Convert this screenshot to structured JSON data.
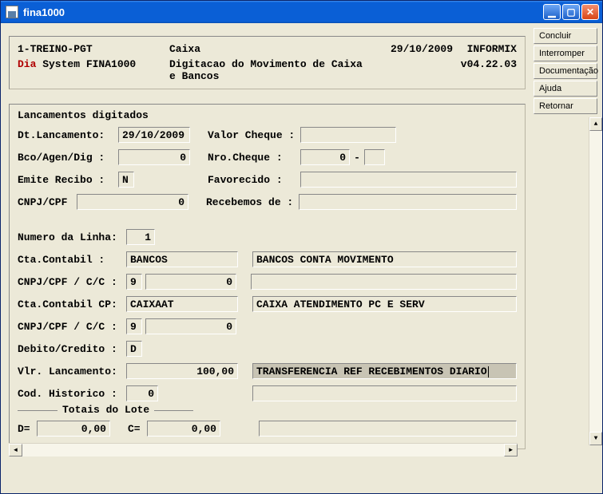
{
  "window": {
    "title": "fina1000"
  },
  "win_buttons": {
    "min": "_",
    "max": "□",
    "close": "X"
  },
  "side_buttons": {
    "concluir": "Concluir",
    "interromper": "Interromper",
    "documentacao": "Documentação",
    "ajuda": "Ajuda",
    "retornar": "Retornar"
  },
  "header": {
    "line1": {
      "left": "1-TREINO-PGT",
      "mid": "Caixa",
      "date": "29/10/2009",
      "right": "INFORMIX"
    },
    "line2": {
      "dia": "Dia",
      "system": " System  FINA1000",
      "mid": "Digitacao do Movimento de Caixa e Bancos",
      "version": "v04.22.03"
    }
  },
  "form": {
    "title": "Lancamentos digitados",
    "labels": {
      "dt_lanc": "Dt.Lancamento:",
      "valor_cheque": "Valor Cheque :",
      "bco_agen": "Bco/Agen/Dig :",
      "nro_cheque": "Nro.Cheque   :",
      "emite_recibo": "Emite Recibo :",
      "favorecido": "Favorecido   :",
      "cnpj_cpf": "CNPJ/CPF",
      "recebemos_de": "Recebemos de :",
      "numero_linha": "Numero da Linha:",
      "cta_contabil": "Cta.Contabil   :",
      "cnpj_cc": "CNPJ/CPF / C/C :",
      "cta_contabil_cp": "Cta.Contabil CP:",
      "debito_credito": "Debito/Credito :",
      "vlr_lancamento": "Vlr. Lancamento:",
      "cod_historico": "Cod. Historico :",
      "totais_lote": "Totais do Lote",
      "d_eq": "D=",
      "c_eq": "C="
    },
    "values": {
      "dt_lanc": "29/10/2009",
      "valor_cheque": "",
      "bco_agen": "0",
      "nro_cheque": "0",
      "nro_cheque_suf": "",
      "emite_recibo": "N",
      "favorecido": "",
      "cnpj_cpf": "0",
      "recebemos_de": "",
      "numero_linha": "1",
      "cta_contabil": "BANCOS",
      "cta_contabil_desc": "BANCOS CONTA MOVIMENTO",
      "cnpj_cc_a": "9",
      "cnpj_cc_b": "0",
      "cta_contabil_cp": "CAIXAAT",
      "cta_contabil_cp_desc": "CAIXA ATENDIMENTO PC E SERV",
      "cnpj_cc2_a": "9",
      "cnpj_cc2_b": "0",
      "debito_credito": "D",
      "vlr_lancamento": "100,00",
      "vlr_lancamento_desc": "TRANSFERENCIA REF RECEBIMENTOS DIARIO",
      "cod_historico": "0",
      "cod_historico_desc": "",
      "extra_desc": "",
      "total_d": "0,00",
      "total_c": "0,00"
    },
    "dash": "-"
  }
}
